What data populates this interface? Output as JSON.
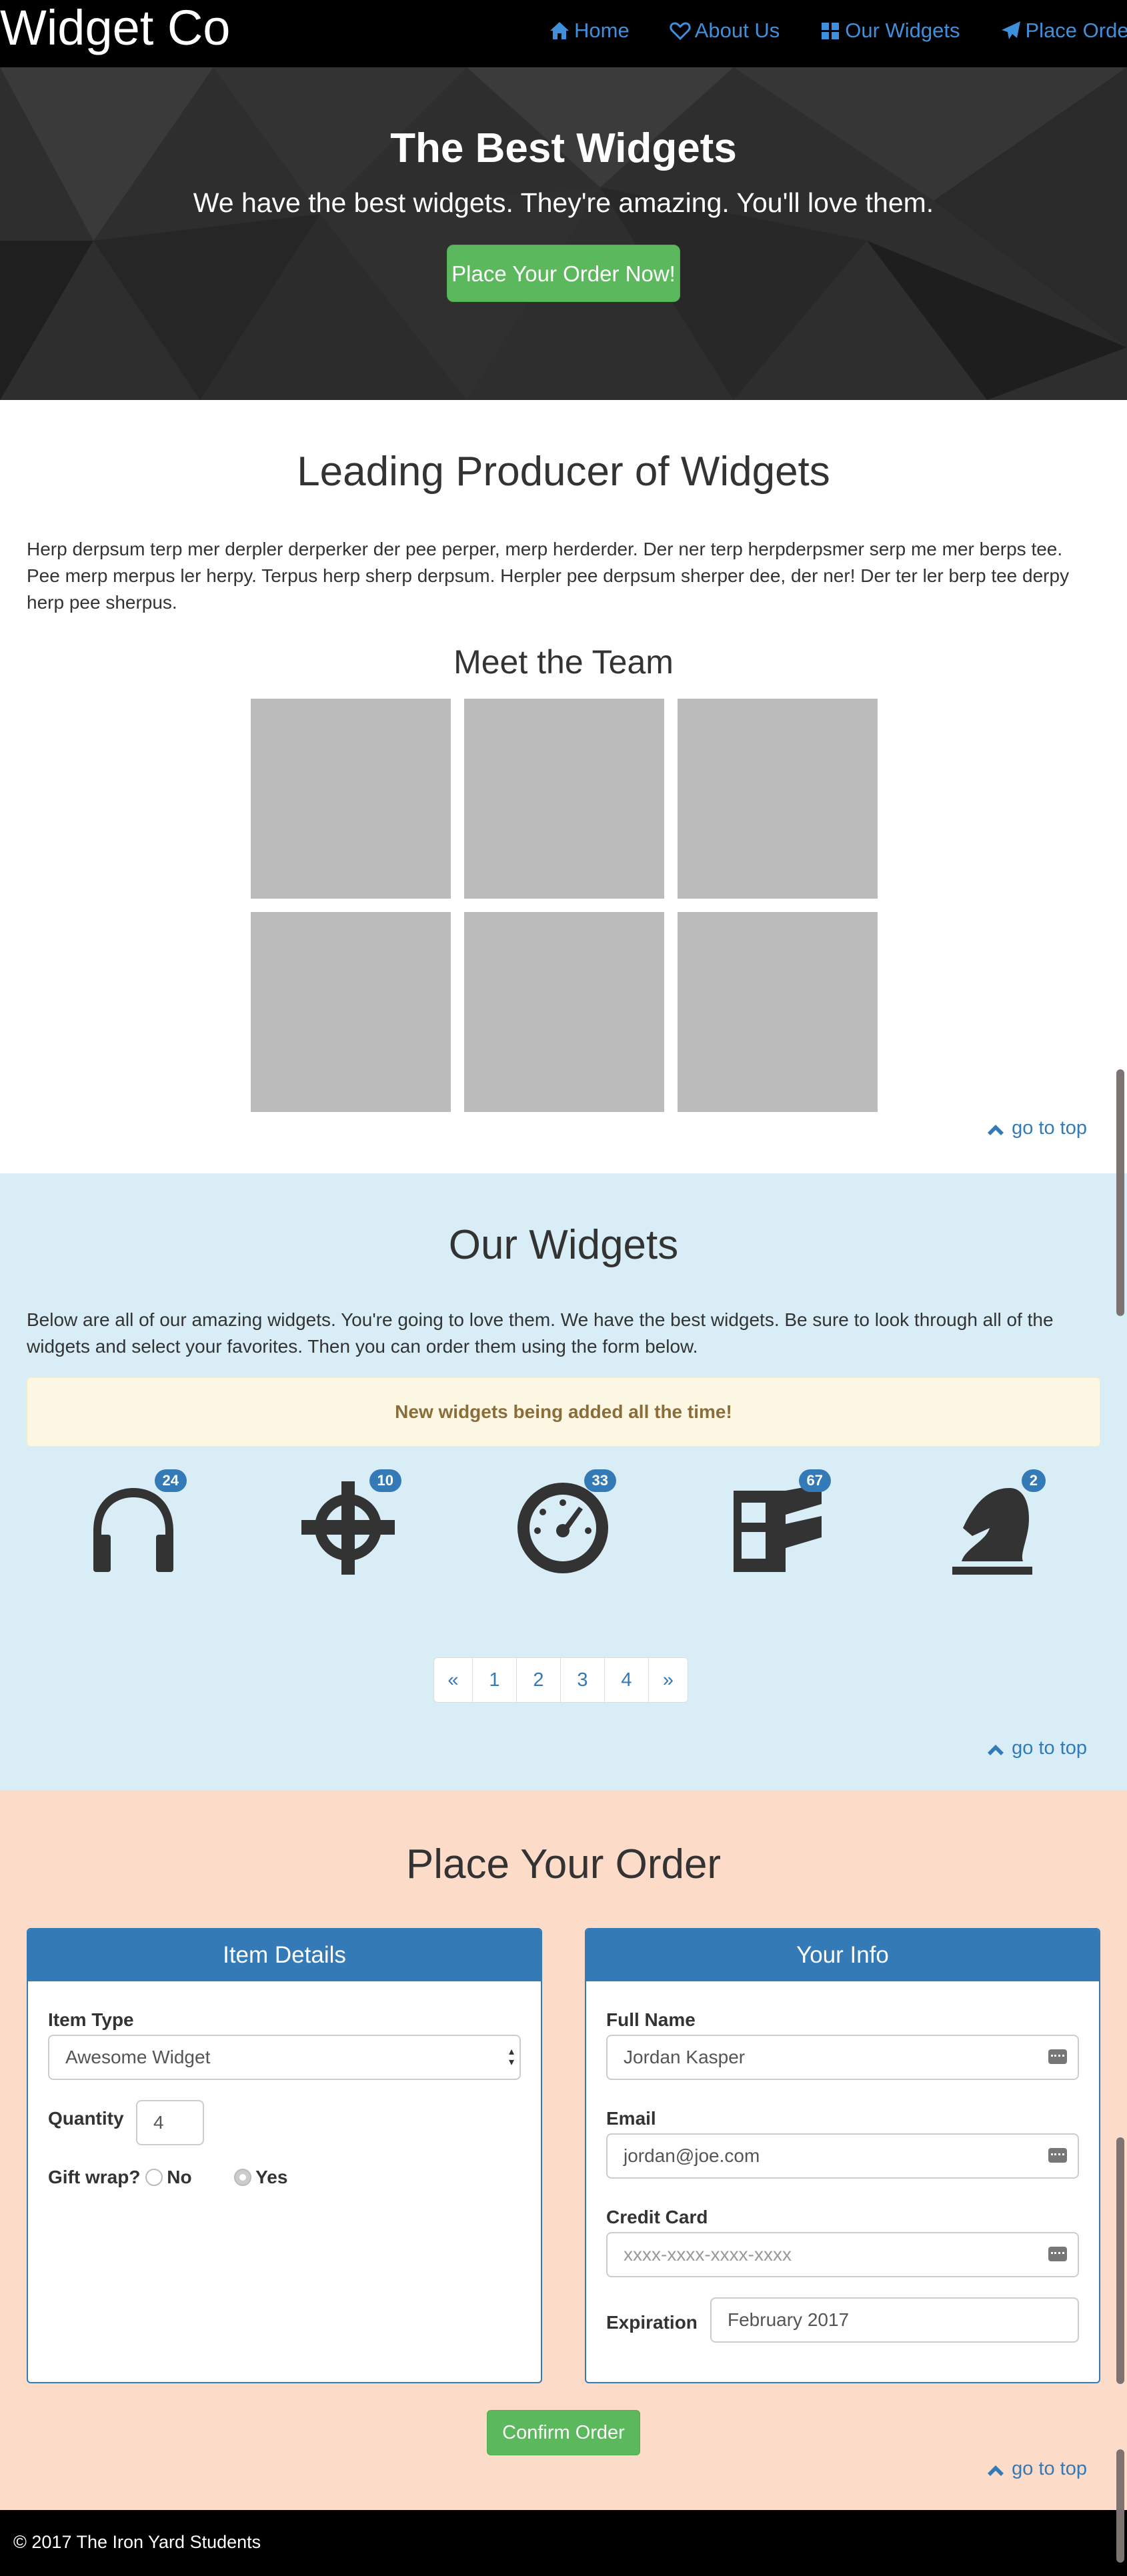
{
  "navbar": {
    "brand": "Widget Co",
    "items": [
      {
        "label": "Home",
        "icon": "home-icon"
      },
      {
        "label": "About Us",
        "icon": "heart-icon"
      },
      {
        "label": "Our Widgets",
        "icon": "gift-icon"
      },
      {
        "label": "Place Order",
        "icon": "paper-plane-icon"
      }
    ]
  },
  "hero": {
    "title": "The Best Widgets",
    "subtitle": "We have the best widgets. They're amazing. You'll love them.",
    "cta": "Place Your Order Now!"
  },
  "about": {
    "heading": "Leading Producer of Widgets",
    "paragraph": "Herp derpsum terp mer derpler derperker der pee perper, merp herderder. Der ner terp herpderpsmer serp me mer berps tee. Pee merp merpus ler herpy. Terpus herp sherp derpsum. Herpler pee derpsum sherper dee, der ner! Der ter ler berp tee derpy herp pee sherpus.",
    "team_heading": "Meet the Team",
    "go_top": "go to top"
  },
  "widgets": {
    "heading": "Our Widgets",
    "paragraph": "Below are all of our amazing widgets. You're going to love them. We have the best widgets. Be sure to look through all of the widgets and select your favorites. Then you can order them using the form below.",
    "alert": "New widgets being added all the time!",
    "items": [
      {
        "icon": "headphones-icon",
        "count": "24"
      },
      {
        "icon": "crosshair-icon",
        "count": "10"
      },
      {
        "icon": "dashboard-icon",
        "count": "33"
      },
      {
        "icon": "film-icon",
        "count": "67"
      },
      {
        "icon": "knight-icon",
        "count": "2"
      }
    ],
    "pages": [
      "«",
      "1",
      "2",
      "3",
      "4",
      "»"
    ],
    "go_top": "go to top"
  },
  "order": {
    "heading": "Place Your Order",
    "item_panel": {
      "title": "Item Details",
      "item_type_label": "Item Type",
      "item_type_value": "Awesome Widget",
      "quantity_label": "Quantity",
      "quantity_value": "4",
      "gift_label": "Gift wrap?",
      "gift_no": "No",
      "gift_yes": "Yes"
    },
    "info_panel": {
      "title": "Your Info",
      "name_label": "Full Name",
      "name_value": "Jordan Kasper",
      "email_label": "Email",
      "email_value": "jordan@joe.com",
      "card_label": "Credit Card",
      "card_placeholder": "xxxx-xxxx-xxxx-xxxx",
      "exp_label": "Expiration",
      "exp_value": "February  2017"
    },
    "confirm": "Confirm Order",
    "go_top": "go to top"
  },
  "footer": {
    "text": "© 2017 The Iron Yard Students"
  },
  "colors": {
    "link": "#337ab7",
    "success": "#5cb85c",
    "widgets_bg": "#d9edf7",
    "order_bg": "#fddbc9",
    "alert_bg": "#fcf8e3"
  }
}
